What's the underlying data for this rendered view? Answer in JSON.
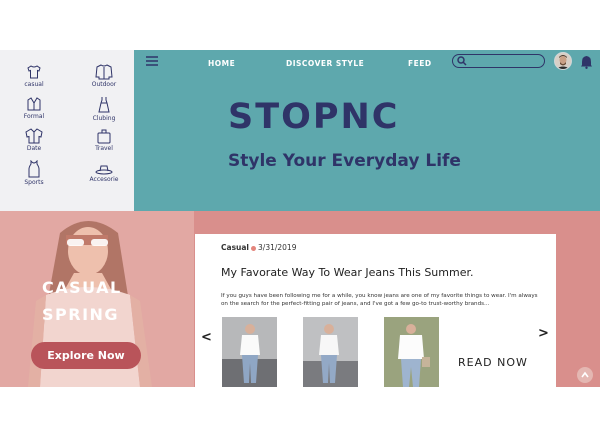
{
  "colors": {
    "navy": "#2f3468",
    "teal": "#5ea8ad",
    "pink": "#d98f8c",
    "button": "#b9545a",
    "accent_dot": "#e4857c"
  },
  "categories": [
    {
      "label": "casual",
      "icon": "tshirt-icon"
    },
    {
      "label": "Outdoor",
      "icon": "jacket-icon"
    },
    {
      "label": "Formal",
      "icon": "blazer-icon"
    },
    {
      "label": "Clubing",
      "icon": "dress-icon"
    },
    {
      "label": "Date",
      "icon": "shirt-icon"
    },
    {
      "label": "Travel",
      "icon": "suitcase-icon"
    },
    {
      "label": "Sports",
      "icon": "tank-top-icon"
    },
    {
      "label": "Accesorie",
      "icon": "hat-icon"
    }
  ],
  "nav": {
    "home": "HOME",
    "discover": "DISCOVER STYLE",
    "feed": "FEED"
  },
  "search": {
    "placeholder": ""
  },
  "hero": {
    "logo": "STOPNC",
    "tagline": "Style Your Everyday Life"
  },
  "promo": {
    "title_line1": "CASUAL",
    "title_line2": "SPRING",
    "button": "Explore Now"
  },
  "post": {
    "category": "Casual",
    "date": "3/31/2019",
    "title": "My Favorate Way To Wear Jeans This Summer.",
    "excerpt": "If you guys have been following me for a while, you know jeans are one of my favorite things to wear. I'm always on the search for the perfect-fitting pair of jeans, and I've got a few go-to trust-worthy brands...",
    "read_more": "READ NOW",
    "prev": "<",
    "next": ">"
  }
}
